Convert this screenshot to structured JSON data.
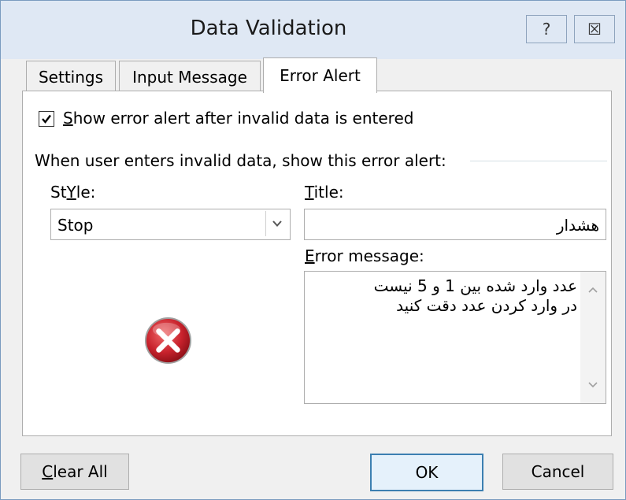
{
  "window": {
    "title": "Data Validation",
    "help_glyph": "?",
    "close_glyph": "☒"
  },
  "tabs": [
    {
      "label": "Settings",
      "active": false
    },
    {
      "label": "Input Message",
      "active": false
    },
    {
      "label": "Error Alert",
      "active": true
    }
  ],
  "error_alert": {
    "show_checkbox": {
      "checked": true,
      "mnemonic": "S",
      "label_rest": "how error alert after invalid data is entered"
    },
    "group_label": "When user enters invalid data, show this error alert:",
    "style": {
      "label_mnemonic": "Y",
      "label_prefix": "St",
      "label_suffix": "le:",
      "value": "Stop"
    },
    "title": {
      "label_mnemonic": "T",
      "label_rest": "itle:",
      "value": "هشدار"
    },
    "error_message": {
      "label_mnemonic": "E",
      "label_rest": "rror message:",
      "value": "عدد وارد شده بین 1 و 5 نیست\nدر وارد کردن عدد دقت کنید"
    },
    "icon": "error-stop-icon"
  },
  "buttons": {
    "clear_all": {
      "mnemonic": "C",
      "rest": "lear All"
    },
    "ok": "OK",
    "cancel": "Cancel"
  },
  "colors": {
    "titlebar": "#dfe8f4",
    "error_icon": "#c8222c",
    "default_button_border": "#3c7fb1"
  }
}
